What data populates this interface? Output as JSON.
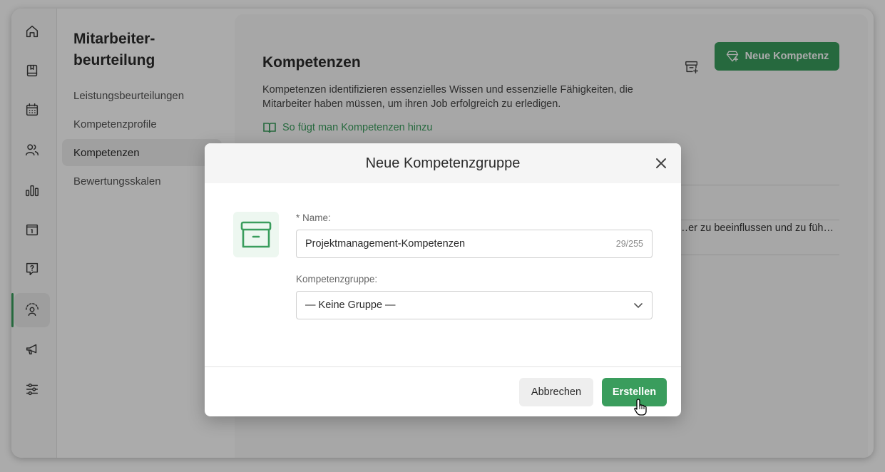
{
  "sidebar": {
    "title": "Mitarbeiter-\nbeurteilung",
    "items": [
      {
        "label": "Leistungsbeurteilungen"
      },
      {
        "label": "Kompetenzprofile"
      },
      {
        "label": "Kompetenzen"
      },
      {
        "label": "Bewertungsskalen"
      }
    ],
    "active_item": "Kompetenzen"
  },
  "rail": {
    "icons": [
      "home-icon",
      "book-icon",
      "calendar-icon",
      "users-icon",
      "chart-icon",
      "info-book-icon",
      "help-icon",
      "review-icon",
      "megaphone-icon",
      "settings-sliders-icon"
    ],
    "active_icon": "review-icon"
  },
  "main": {
    "title": "Kompetenzen",
    "description": "Kompetenzen identifizieren essenzielles Wissen und essenzielle Fähigkeiten, die Mitarbeiter haben müssen, um ihren Job erfolgreich zu erledigen.",
    "help_link": "So fügt man Kompetenzen hinzu",
    "new_button": "Neue Kompetenz",
    "row_text": "Mitarbeiter zu beeinflussen und zu füh…"
  },
  "modal": {
    "title": "Neue Kompetenzgruppe",
    "name_label": "* Name:",
    "name_value": "Projektmanagement-Kompetenzen",
    "name_counter": "29/255",
    "group_label": "Kompetenzgruppe:",
    "group_value": "— Keine Gruppe —",
    "cancel_label": "Abbrechen",
    "create_label": "Erstellen"
  },
  "colors": {
    "accent": "#3a9d5d",
    "accent_light": "#edf7f0"
  }
}
